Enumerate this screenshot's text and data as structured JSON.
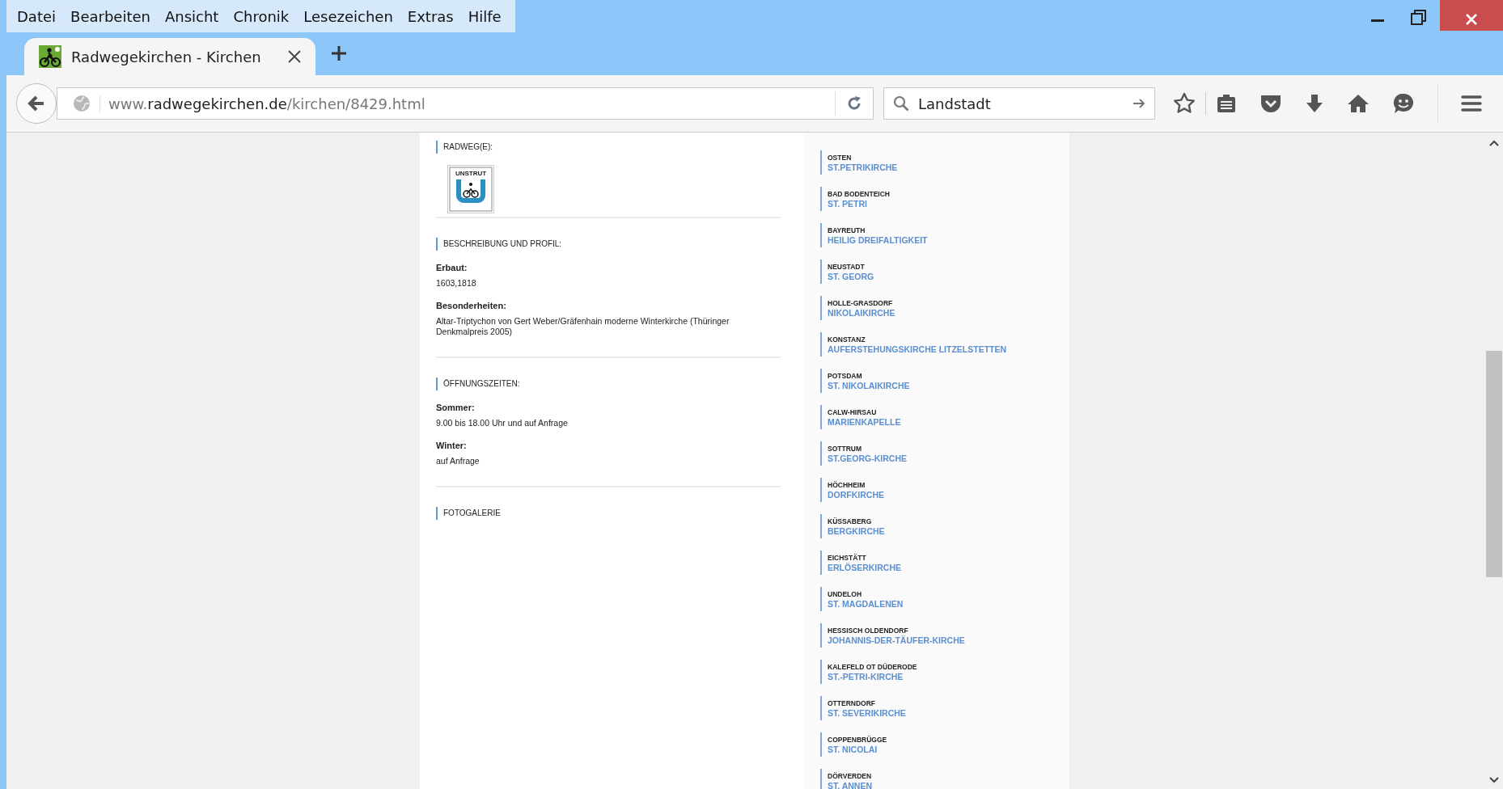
{
  "menu": [
    "Datei",
    "Bearbeiten",
    "Ansicht",
    "Chronik",
    "Lesezeichen",
    "Extras",
    "Hilfe"
  ],
  "tabs": [
    {
      "title": "Radwegekirchen - Kirchen",
      "selected": true
    }
  ],
  "address_bar": {
    "prefix": "www.",
    "domain": "radwegekirchen.de",
    "path": "/kirchen/8429.html"
  },
  "search_field": {
    "value": "Landstadt"
  },
  "radweg": {
    "heading": "RADWEG(E):",
    "logo_text": "UNSTRUT"
  },
  "sections": [
    {
      "heading": "BESCHREIBUNG UND PROFIL:",
      "fields": [
        {
          "label": "Erbaut:",
          "value": "1603,1818"
        },
        {
          "label": "Besonderheiten:",
          "value": "Altar-Triptychon von Gert Weber/Gräfenhain moderne Winterkirche (Thüringer Denkmalpreis 2005)"
        }
      ]
    },
    {
      "heading": "ÖFFNUNGSZEITEN:",
      "fields": [
        {
          "label": "Sommer:",
          "value": "9.00 bis 18.00 Uhr und auf Anfrage"
        },
        {
          "label": "Winter:",
          "value": "auf Anfrage"
        }
      ]
    },
    {
      "heading": "FOTOGALERIE"
    }
  ],
  "churches": [
    {
      "town": "OSTEN",
      "name": "ST.PETRIKIRCHE"
    },
    {
      "town": "BAD BODENTEICH",
      "name": "ST. PETRI"
    },
    {
      "town": "BAYREUTH",
      "name": "HEILIG DREIFALTIGKEIT"
    },
    {
      "town": "NEUSTADT",
      "name": "ST. GEORG"
    },
    {
      "town": "HOLLE-GRASDORF",
      "name": "NIKOLAIKIRCHE"
    },
    {
      "town": "KONSTANZ",
      "name": "AUFERSTEHUNGSKIRCHE LITZELSTETTEN"
    },
    {
      "town": "POTSDAM",
      "name": "ST. NIKOLAIKIRCHE"
    },
    {
      "town": "CALW-HIRSAU",
      "name": "MARIENKAPELLE"
    },
    {
      "town": "SOTTRUM",
      "name": "ST.GEORG-KIRCHE"
    },
    {
      "town": "HÖCHHEIM",
      "name": "DORFKIRCHE"
    },
    {
      "town": "KÜSSABERG",
      "name": "BERGKIRCHE"
    },
    {
      "town": "EICHSTÄTT",
      "name": "ERLÖSERKIRCHE"
    },
    {
      "town": "UNDELOH",
      "name": "ST. MAGDALENEN"
    },
    {
      "town": "HESSISCH OLDENDORF",
      "name": "JOHANNIS-DER-TÄUFER-KIRCHE"
    },
    {
      "town": "KALEFELD OT DÜDERODE",
      "name": "ST.-PETRI-KIRCHE"
    },
    {
      "town": "OTTERNDORF",
      "name": "ST. SEVERIKIRCHE"
    },
    {
      "town": "COPPENBRÜGGE",
      "name": "ST. NICOLAI"
    },
    {
      "town": "DÖRVERDEN",
      "name": "ST. ANNEN"
    }
  ]
}
